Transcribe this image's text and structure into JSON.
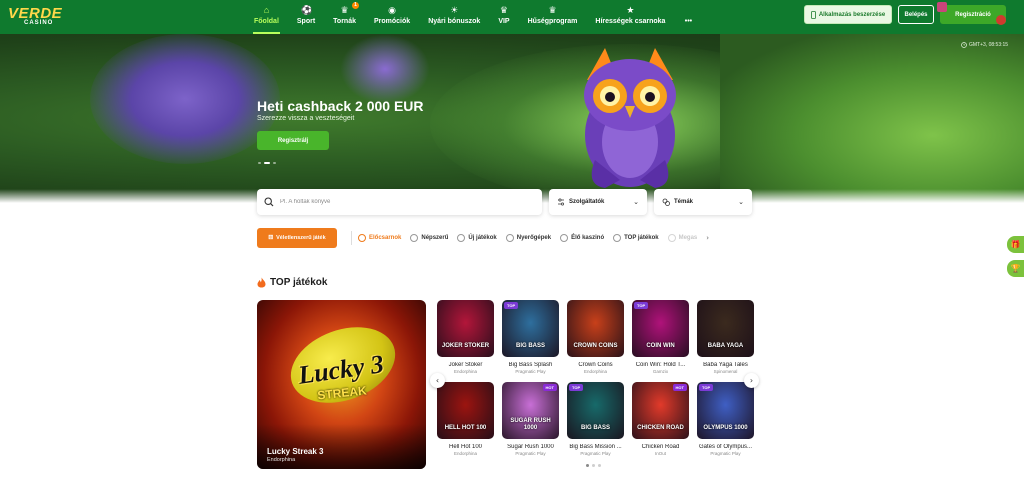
{
  "brand": {
    "logo_text": "VERDE",
    "logo_sub": "CASINO"
  },
  "nav": [
    {
      "label": "Főoldal",
      "icon": "home-icon",
      "active": true
    },
    {
      "label": "Sport",
      "icon": "soccer-ball-icon"
    },
    {
      "label": "Tornák",
      "icon": "trophy-icon",
      "badge": "1"
    },
    {
      "label": "Promóciók",
      "icon": "chip-icon"
    },
    {
      "label": "Nyári bónuszok",
      "icon": "sun-icon"
    },
    {
      "label": "VIP",
      "icon": "crown-icon"
    },
    {
      "label": "Hűségprogram",
      "icon": "crown-icon"
    },
    {
      "label": "Hírességek csarnoka",
      "icon": "star-icon"
    },
    {
      "label": "•••",
      "icon": "more-icon"
    }
  ],
  "header_actions": {
    "app_label": "Alkalmazás beszerzése",
    "login_label": "Belépés",
    "register_label": "Regisztráció"
  },
  "banner": {
    "title": "Heti cashback 2 000 EUR",
    "subtitle": "Szerezze vissza a veszteségeit",
    "cta_label": "Regisztrálj",
    "clock": "GMT+3, 08:53:15",
    "slide_count": 3,
    "active_slide": 1
  },
  "search": {
    "placeholder": "Pl. A holtak könyve",
    "providers_label": "Szolgáltatók",
    "topics_label": "Témák"
  },
  "categories": {
    "random_label": "Véletlenszerű játék",
    "items": [
      {
        "label": "Előcsarnok",
        "active": true
      },
      {
        "label": "Népszerű"
      },
      {
        "label": "Új játékok"
      },
      {
        "label": "Nyerőgépek"
      },
      {
        "label": "Élő kaszinó"
      },
      {
        "label": "TOP játékok"
      },
      {
        "label": "Megas",
        "faded": true
      }
    ]
  },
  "top_games": {
    "title": "TOP játékok",
    "featured": {
      "name": "Lucky Streak 3",
      "provider": "Endorphina",
      "art_line1": "Lucky 3",
      "art_line2": "STREAK"
    },
    "games": [
      {
        "name": "Joker Stoker",
        "provider": "Endorphina",
        "art": "JOKER STOKER",
        "color": "#b3163a"
      },
      {
        "name": "Big Bass Splash",
        "provider": "Pragmatic Play",
        "art": "BIG BASS",
        "color": "#2e6f9e",
        "badge": "TOP"
      },
      {
        "name": "Crown Coins",
        "provider": "Endorphina",
        "art": "CROWN COINS",
        "color": "#c8401a"
      },
      {
        "name": "Coin Win: Hold T...",
        "provider": "Gamzix",
        "art": "COIN WIN",
        "color": "#b0127a",
        "badge": "TOP"
      },
      {
        "name": "Baba Yaga Tales",
        "provider": "Spinomenal",
        "art": "BABA YAGA",
        "color": "#3b2a1e"
      },
      {
        "name": "Hell Hot 100",
        "provider": "Endorphina",
        "art": "HELL HOT 100",
        "color": "#9c1410"
      },
      {
        "name": "Sugar Rush 1000",
        "provider": "Pragmatic Play",
        "art": "SUGAR RUSH 1000",
        "color": "#c86fd6",
        "badge": "HOT"
      },
      {
        "name": "Big Bass Mission ...",
        "provider": "Pragmatic Play",
        "art": "BIG BASS",
        "color": "#176a6a",
        "badge": "TOP"
      },
      {
        "name": "Chicken Road",
        "provider": "InOut",
        "art": "CHICKEN ROAD",
        "color": "#e23a2a",
        "badge": "HOT"
      },
      {
        "name": "Gates of Olympus...",
        "provider": "Pragmatic Play",
        "art": "OLYMPUS 1000",
        "color": "#3f5fc4",
        "badge": "TOP"
      }
    ],
    "pages": 3,
    "active_page": 1
  }
}
